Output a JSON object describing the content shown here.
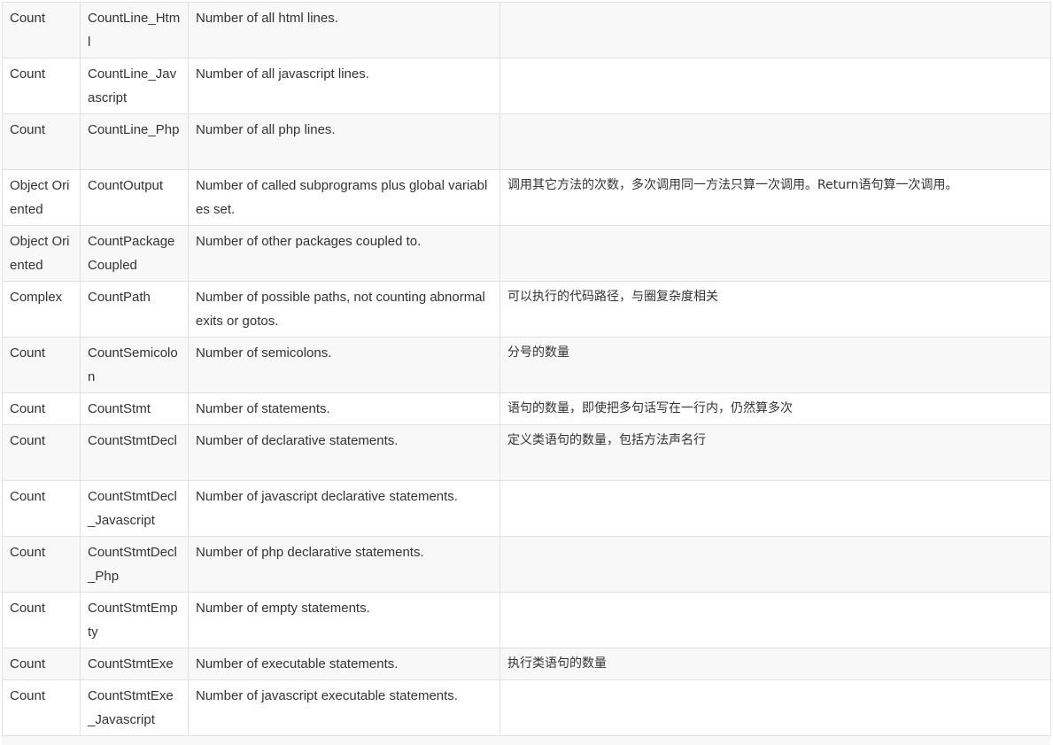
{
  "rows": [
    {
      "category": "Count",
      "name": "CountLine_Html",
      "description": "Number of all html lines.",
      "note": ""
    },
    {
      "category": "Count",
      "name": "CountLine_Javascript",
      "description": "Number of all javascript lines.",
      "note": ""
    },
    {
      "category": "Count",
      "name": "CountLine_Php",
      "description": "Number of all php lines.",
      "note": ""
    },
    {
      "category": "Object Oriented",
      "name": "CountOutput",
      "description": "Number of called subprograms plus global variables set.",
      "note": "调用其它方法的次数，多次调用同一方法只算一次调用。Return语句算一次调用。"
    },
    {
      "category": "Object Oriented",
      "name": "CountPackageCoupled",
      "description": "Number of other packages coupled to.",
      "note": ""
    },
    {
      "category": "Complex",
      "name": "CountPath",
      "description": "Number of possible paths, not counting abnormal exits or gotos.",
      "note": "可以执行的代码路径，与圈复杂度相关"
    },
    {
      "category": "Count",
      "name": "CountSemicolon",
      "description": "Number of semicolons.",
      "note": "分号的数量"
    },
    {
      "category": "Count",
      "name": "CountStmt",
      "description": "Number of statements.",
      "note": "语句的数量，即使把多句话写在一行内，仍然算多次"
    },
    {
      "category": "Count",
      "name": "CountStmtDecl",
      "description": "Number of declarative statements.",
      "note": "定义类语句的数量，包括方法声名行"
    },
    {
      "category": "Count",
      "name": "CountStmtDecl_Javascript",
      "description": "Number of javascript declarative statements.",
      "note": ""
    },
    {
      "category": "Count",
      "name": "CountStmtDecl_Php",
      "description": "Number of php declarative statements.",
      "note": ""
    },
    {
      "category": "Count",
      "name": "CountStmtEmpty",
      "description": "Number of empty statements.",
      "note": ""
    },
    {
      "category": "Count",
      "name": "CountStmtExe",
      "description": "Number of executable statements.",
      "note": "执行类语句的数量"
    },
    {
      "category": "Count",
      "name": "CountStmtExe_Javascript",
      "description": "Number of javascript executable statements.",
      "note": ""
    }
  ]
}
